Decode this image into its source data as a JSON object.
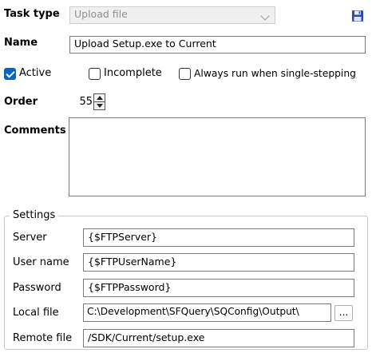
{
  "task_type": {
    "label": "Task type",
    "value": "Upload file"
  },
  "name": {
    "label": "Name",
    "value": "Upload Setup.exe to Current"
  },
  "checkboxes": {
    "active": {
      "label": "Active",
      "checked": true
    },
    "incomplete": {
      "label": "Incomplete",
      "checked": false
    },
    "always_run": {
      "label": "Always run when single-stepping",
      "checked": false
    }
  },
  "order": {
    "label": "Order",
    "value": "55"
  },
  "comments": {
    "label": "Comments",
    "value": ""
  },
  "settings": {
    "title": "Settings",
    "server": {
      "label": "Server",
      "value": "{$FTPServer}"
    },
    "user_name": {
      "label": "User name",
      "value": "{$FTPUserName}"
    },
    "password": {
      "label": "Password",
      "value": "{$FTPPassword}"
    },
    "local_file": {
      "label": "Local file",
      "value": "C:\\Development\\SFQuery\\SQConfig\\Output\\",
      "browse_label": "..."
    },
    "remote_file": {
      "label": "Remote file",
      "value": "/SDK/Current/setup.exe"
    }
  },
  "icons": {
    "save": "floppy-disk-icon"
  },
  "colors": {
    "accent": "#0067c0",
    "save_icon": "#2a4bb3"
  }
}
